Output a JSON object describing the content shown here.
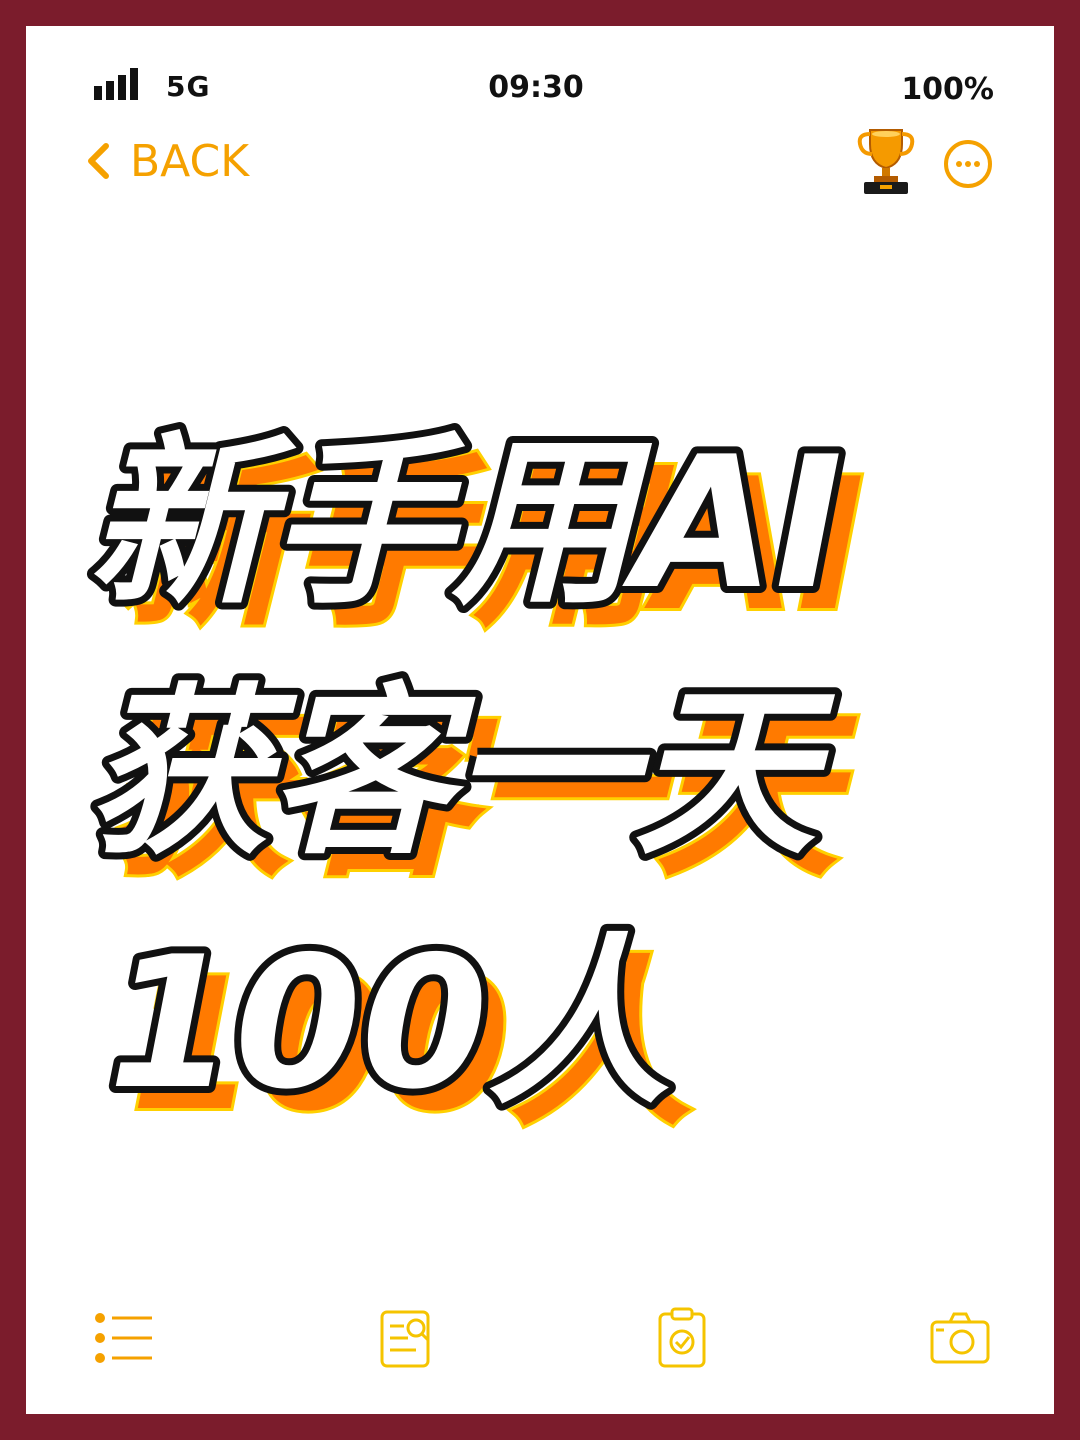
{
  "status_bar": {
    "network": "5G",
    "time": "09:30",
    "battery": "100%"
  },
  "nav": {
    "back_label": "BACK",
    "back_icon": "chevron-left-icon",
    "trophy_icon": "trophy-icon",
    "more_icon": "more-dots-icon"
  },
  "headline": {
    "line1": "新手用AI",
    "line2": "获客一天",
    "line3": "100人"
  },
  "toolbar": {
    "items": [
      {
        "icon": "list-icon"
      },
      {
        "icon": "report-search-icon"
      },
      {
        "icon": "clipboard-check-icon"
      },
      {
        "icon": "camera-icon"
      }
    ]
  },
  "colors": {
    "frame": "#7b1c2c",
    "accent": "#f5a100",
    "shadow": "#ff7a00"
  }
}
